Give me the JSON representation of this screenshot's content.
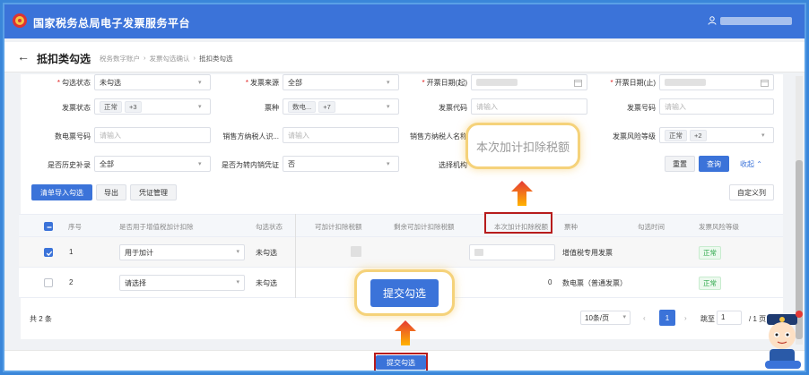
{
  "app": {
    "title": "国家税务总局电子发票服务平台"
  },
  "header": {
    "page_title": "抵扣类勾选",
    "breadcrumb": [
      "税务数字账户",
      "发票勾选确认",
      "抵扣类勾选"
    ]
  },
  "filters": {
    "select_status": {
      "label": "勾选状态",
      "value": "未勾选"
    },
    "invoice_source": {
      "label": "发票来源",
      "value": "全部"
    },
    "issue_date_start": {
      "label": "开票日期(起)"
    },
    "issue_date_end": {
      "label": "开票日期(止)"
    },
    "invoice_status": {
      "label": "发票状态",
      "tag": "正常",
      "more": "+3"
    },
    "invoice_type": {
      "label": "票种",
      "tag": "数电...",
      "more": "+7"
    },
    "invoice_code": {
      "label": "发票代码",
      "placeholder": "请输入"
    },
    "invoice_number": {
      "label": "发票号码",
      "placeholder": "请输入"
    },
    "digital_invoice_number": {
      "label": "数电票号码",
      "placeholder": "请输入"
    },
    "seller_tax_id": {
      "label": "销售方纳税人识...",
      "placeholder": "请输入"
    },
    "seller_name": {
      "label": "销售方纳税人名称"
    },
    "risk_level": {
      "label": "发票风险等级",
      "tag": "正常",
      "more": "+2"
    },
    "history_supplement": {
      "label": "是否历史补录",
      "value": "全部"
    },
    "transfer_voucher": {
      "label": "是否为转内销凭证",
      "value": "否"
    },
    "select_org": {
      "label": "选择机构"
    }
  },
  "actions": {
    "reset": "重置",
    "query": "查询",
    "collapse": "收起"
  },
  "toolbar": {
    "list_import": "清单导入勾选",
    "export": "导出",
    "voucher_manage": "凭证管理",
    "custom_columns": "自定义列"
  },
  "table": {
    "headers": [
      "序号",
      "是否用于增值税加计扣除",
      "勾选状态",
      "可加计扣除税额",
      "剩余可加计扣除税额",
      "本次加计扣除税额",
      "票种",
      "勾选时间",
      "发票风险等级"
    ],
    "rows": [
      {
        "index": "1",
        "deduction_use": "用于加计",
        "status": "未勾选",
        "amount": "",
        "type": "增值税专用发票",
        "risk": "正常"
      },
      {
        "index": "2",
        "deduction_use": "请选择",
        "status": "未勾选",
        "amount": "0",
        "type": "数电票（普通发票）",
        "risk": "正常"
      }
    ]
  },
  "pagination": {
    "total": "共 2 条",
    "page_size": "10条/页",
    "current": "1",
    "goto_label": "跳至",
    "goto_value": "1",
    "total_pages": "/ 1 页"
  },
  "footer": {
    "submit": "提交勾选"
  },
  "callouts": {
    "deduction_field": "本次加计扣除税额",
    "submit": "提交勾选"
  },
  "colors": {
    "primary": "#3b73d9",
    "highlight_border": "#f5d27a",
    "red_frame": "#b71c1c",
    "success": "#2da84a"
  }
}
